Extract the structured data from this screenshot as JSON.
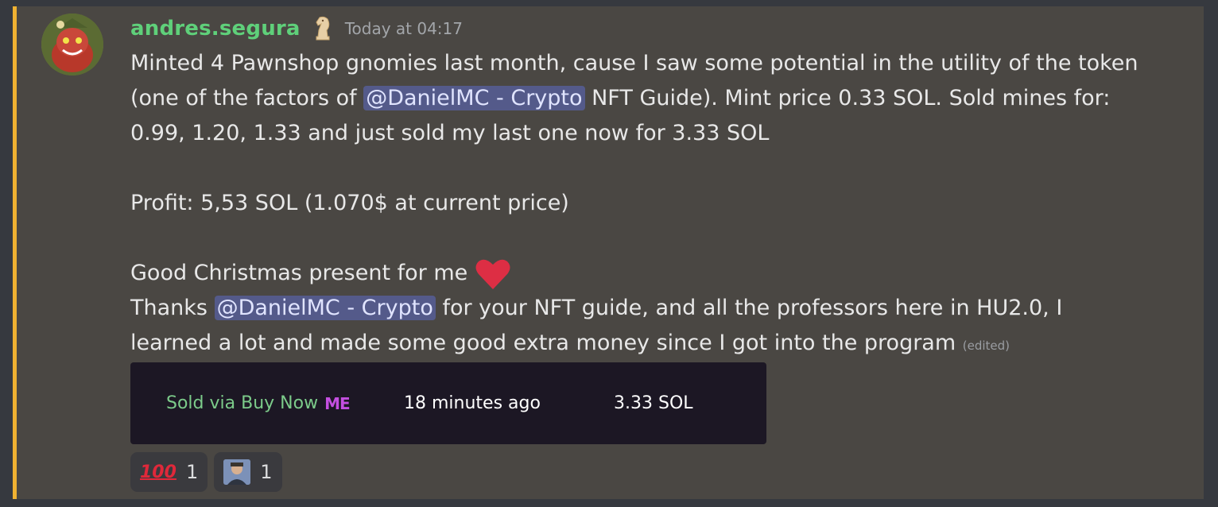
{
  "message": {
    "username": "andres.segura",
    "timestamp": "Today at 04:17",
    "role_icon": "chess-knight-icon",
    "lines": [
      "Minted 4 Pawnshop gnomies last month, cause I saw some potential in the utility of the token",
      "(one of the factors of ",
      "NFT Guide). Mint price 0.33 SOL. Sold mines for:",
      "0.99, 1.20, 1.33 and just sold my last one now for 3.33 SOL",
      "Profit: 5,53 SOL (1.070$ at current price)",
      "Good Christmas present for me ",
      "Thanks ",
      "for your NFT guide, and all the professors here in HU2.0, I",
      "learned a lot and made some good extra money since I got into the program "
    ],
    "mention": "@DanielMC - Crypto",
    "edited": "(edited)",
    "accent_color": "#f0b232"
  },
  "embed": {
    "source": "Sold via Buy Now",
    "source_logo": "ME",
    "time": "18 minutes ago",
    "price": "3.33 SOL"
  },
  "reactions": [
    {
      "emoji": "100",
      "icon": "hundred-points-icon",
      "count": "1"
    },
    {
      "emoji": "avatar",
      "icon": "custom-avatar-emoji-icon",
      "count": "1"
    }
  ]
}
